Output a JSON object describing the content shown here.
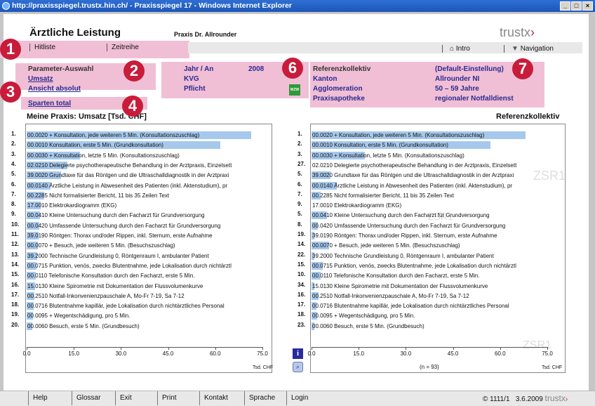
{
  "window": {
    "title": "http://praxisspiegel.trustx.hin.ch/ - Praxisspiegel 17 - Windows Internet Explorer"
  },
  "header": {
    "title": "Ärztliche Leistung",
    "practice": "Praxis Dr. Allrounder",
    "logo": "trustx",
    "tabs": [
      "Hitliste",
      "Zeitreihe"
    ],
    "intro": "Intro",
    "navigation": "Navigation"
  },
  "params": {
    "heading": "Parameter-Auswahl",
    "umsatz": "Umsatz",
    "ansicht": "Ansicht absolut",
    "sparten": "Sparten total",
    "jahr_label": "Jahr / An",
    "jahr_value": "2008",
    "kvg": "KVG",
    "pflicht": "Pflicht",
    "wzw": "WZW"
  },
  "ref": {
    "heading": "Referenzkollektiv",
    "default": "(Default-Einstellung)",
    "kanton_l": "Kanton",
    "kanton_v": "Allrounder NI",
    "agglo_l": "Agglomeration",
    "agglo_v": "50 – 59 Jahre",
    "apo_l": "Praxisapotheke",
    "apo_v": "regionaler Notfalldienst"
  },
  "badges": [
    "1",
    "2",
    "3",
    "4",
    "6",
    "7"
  ],
  "left_title": "Meine Praxis: Umsatz [Tsd. CHF]",
  "right_title": "Referenzkollektiv",
  "unit": "Tsd. CHF",
  "n_label": "(n = 93)",
  "watermarks": [
    "ZSR1",
    "ZSR1",
    "ZSR1"
  ],
  "chart_data": [
    {
      "type": "bar",
      "title": "Meine Praxis: Umsatz [Tsd. CHF]",
      "xlabel": "Tsd. CHF",
      "xlim": [
        0,
        75
      ],
      "xticks": [
        "0.0",
        "15.0",
        "30.0",
        "45.0",
        "60.0",
        "75.0"
      ],
      "ranks": [
        "1.",
        "2.",
        "3.",
        "4.",
        "5.",
        "6.",
        "7.",
        "8.",
        "9.",
        "10.",
        "11.",
        "12.",
        "13.",
        "14.",
        "15.",
        "16.",
        "17.",
        "18.",
        "19.",
        "20."
      ],
      "categories": [
        "00.0020 + Konsultation, jede weiteren 5 Min. (Konsultationszuschlag)",
        "00.0010 Konsultation, erste 5 Min. (Grundkonsultation)",
        "00.0030 + Konsultation, letzte 5 Min. (Konsultationszuschlag)",
        "02.0210 Delegierte psychotherapeutische Behandlung in der Arztpraxis, Einzelsett",
        "39.0020 Grundtaxe für das Röntgen und die Ultraschalldiagnostik in der Arztpraxi",
        "00.0140 Ärztliche Leistung in Abwesenheit des Patienten (inkl. Aktenstudium), pr",
        "00.2285 Nicht formalisierter Bericht, 11 bis 35 Zeilen Text",
        "17.0010 Elektrokardiogramm (EKG)",
        "00.0410 Kleine Untersuchung durch den Facharzt für Grundversorgung",
        "00.0420 Umfassende Untersuchung durch den Facharzt für Grundversorgung",
        "39.0190 Röntgen: Thorax und/oder Rippen, inkl. Sternum, erste Aufnahme",
        "00.0070 + Besuch, jede weiteren 5 Min. (Besuchszuschlag)",
        "39.2000 Technische Grundleistung 0, Röntgenraum I, ambulanter Patient",
        "00.0715 Punktion, venös, zwecks Blutentnahme, jede Lokalisation durch nichtärztl",
        "00.0110 Telefonische Konsultation durch den Facharzt, erste 5 Min.",
        "15.0130 Kleine Spirometrie mit Dokumentation der Flussvolumenkurve",
        "00.2510 Notfall-Inkonvenienzpauschale A, Mo-Fr 7-19, Sa 7-12",
        "00.0716 Blutentnahme kapillär, jede Lokalisation durch nichtärztliches Personal",
        "00.0095 + Wegentschädigung, pro 5 Min.",
        "00.0060 Besuch, erste 5 Min. (Grundbesuch)"
      ],
      "values": [
        71.5,
        61.5,
        17,
        13,
        11,
        7.5,
        5.5,
        4.5,
        4.3,
        4,
        3.8,
        3.5,
        3.3,
        3.1,
        2.9,
        2.7,
        2.5,
        2.3,
        2.1,
        1.8
      ]
    },
    {
      "type": "bar",
      "title": "Referenzkollektiv",
      "xlabel": "Tsd. CHF",
      "xlim": [
        0,
        75
      ],
      "xticks": [
        "0.0",
        "15.0",
        "30.0",
        "45.0",
        "60.0",
        "75.0"
      ],
      "ranks": [
        "1.",
        "2.",
        "3.",
        "27.",
        "5.",
        "6.",
        "7.",
        "9.",
        "5.",
        "8.",
        "19.",
        "14.",
        "22.",
        "15.",
        "10.",
        "34.",
        "16.",
        "17.",
        "18.",
        "23."
      ],
      "values": [
        68,
        57,
        17,
        0,
        6,
        8,
        3,
        0,
        5,
        2,
        1,
        5.5,
        1,
        3.5,
        3,
        1,
        2.3,
        1.5,
        1.8,
        1
      ]
    }
  ]
}
